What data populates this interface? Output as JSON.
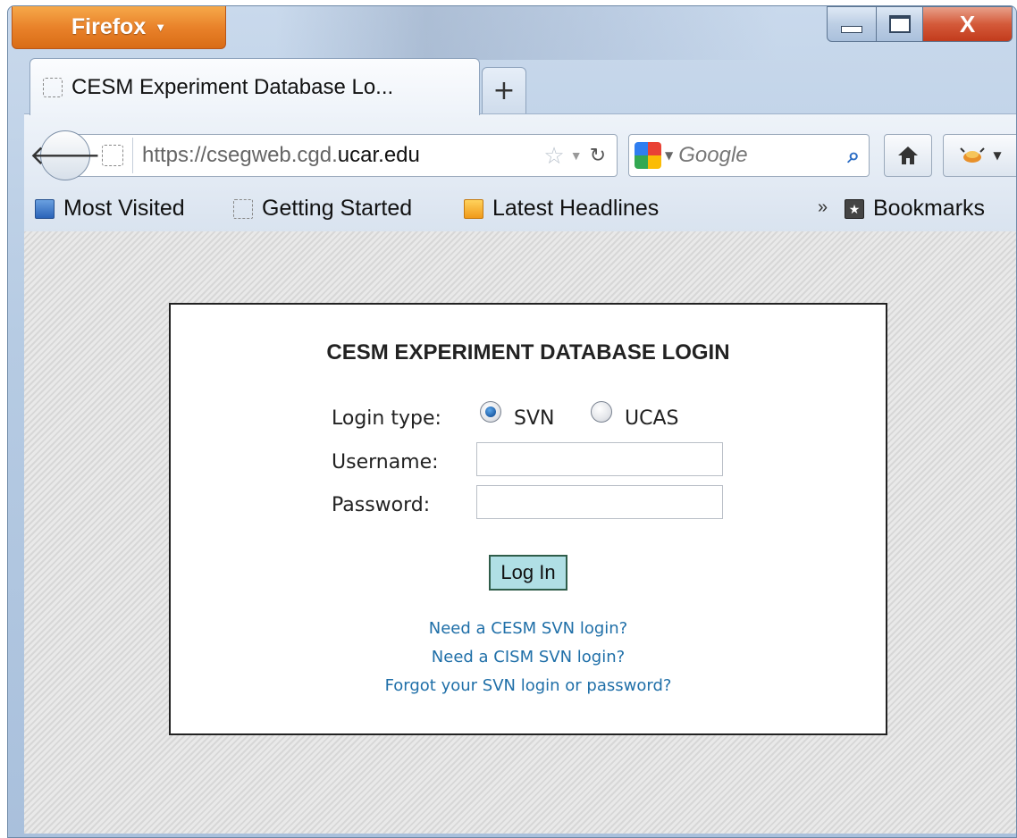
{
  "browser": {
    "app_button_label": "Firefox",
    "close_label": "X"
  },
  "tab": {
    "title": "CESM Experiment Database Lo...",
    "new_tab_label": "+"
  },
  "navbar": {
    "url_prefix": "https://csegweb.cgd.",
    "url_host": "ucar.edu",
    "search_placeholder": "Google",
    "icons": [
      "back-arrow-icon",
      "site-identity-icon",
      "bookmark-star-icon",
      "reload-icon",
      "google-icon",
      "search-icon",
      "home-icon",
      "firebug-icon"
    ]
  },
  "bookmarks": {
    "items": [
      {
        "label": "Most Visited",
        "icon": "most-visited-icon"
      },
      {
        "label": "Getting Started",
        "icon": "blank-page-icon"
      },
      {
        "label": "Latest Headlines",
        "icon": "rss-feed-icon"
      }
    ],
    "overflow_label": "»",
    "bookmarks_label": "Bookmarks"
  },
  "login": {
    "title": "CESM EXPERIMENT DATABASE LOGIN",
    "login_type_label": "Login type:",
    "options": [
      {
        "label": "SVN",
        "checked": true
      },
      {
        "label": "UCAS",
        "checked": false
      }
    ],
    "username_label": "Username:",
    "username_value": "",
    "password_label": "Password:",
    "password_value": "",
    "submit_label": "Log In",
    "links": [
      "Need a CESM SVN login?",
      "Need a CISM SVN login?",
      "Forgot your SVN login or password?"
    ]
  },
  "colors": {
    "firefox_orange": "#e9822a",
    "login_button_bg": "#b0dfe5",
    "link_color": "#1f6fa8",
    "close_red": "#d45a3a"
  }
}
